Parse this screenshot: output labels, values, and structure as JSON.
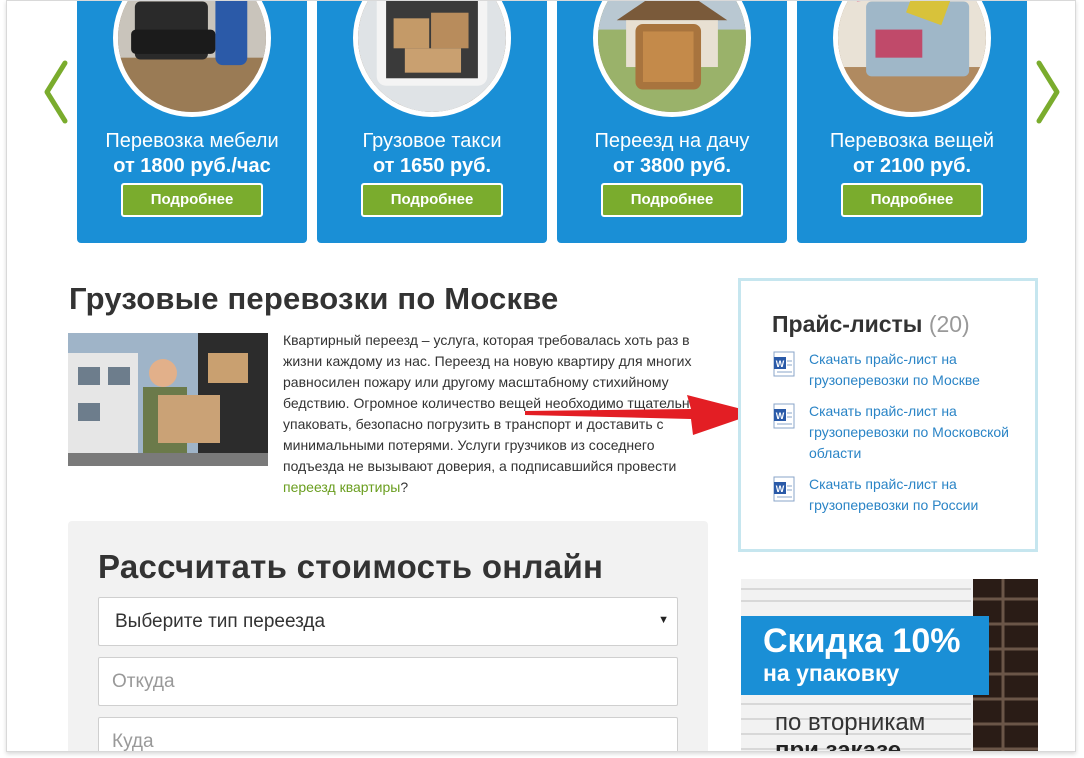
{
  "carousel": {
    "cards": [
      {
        "title": "Перевозка мебели",
        "price": "от 1800 руб./час",
        "button": "Подробнее"
      },
      {
        "title": "Грузовое такси",
        "price": "от 1650 руб.",
        "button": "Подробнее"
      },
      {
        "title": "Переезд на дачу",
        "price": "от 3800 руб.",
        "button": "Подробнее"
      },
      {
        "title": "Перевозка вещей",
        "price": "от 2100 руб.",
        "button": "Подробнее"
      }
    ],
    "icons": {
      "prev": "chevron-left-icon",
      "next": "chevron-right-icon"
    }
  },
  "main": {
    "title": "Грузовые перевозки по Москве",
    "intro": "Квартирный переезд – услуга, которая требовалась хоть раз в жизни каждому из нас. Переезд на новую квартиру для многих равносилен пожару или другому масштабному стихийному бедствию. Огромное количество вещей необходимо тщательно упаковать, безопасно погрузить в транспорт и доставить с минимальными потерями. Услуги грузчиков из соседнего подъезда не вызывают доверия, а подписавшийся провести ",
    "intro_link": "переезд квартиры",
    "intro_end": "?"
  },
  "price_lists": {
    "title": "Прайс-листы",
    "count": "(20)",
    "items": [
      {
        "label": "Скачать прайс-лист на грузоперевозки по Москве"
      },
      {
        "label": "Скачать прайс-лист на грузоперевозки по Московской области"
      },
      {
        "label": "Скачать прайс-лист на грузоперевозки по России"
      }
    ],
    "icon": "word-document-icon"
  },
  "calculator": {
    "title": "Рассчитать стоимость онлайн",
    "select_value": "Выберите тип переезда",
    "from_placeholder": "Откуда",
    "to_placeholder": "Куда"
  },
  "promo": {
    "big": "Скидка 10%",
    "small": "на упаковку",
    "line1": "по вторникам",
    "line2": "при заказе"
  },
  "colors": {
    "card_blue": "#1a8fd6",
    "button_green": "#7aac2d",
    "link_blue": "#2a84c6",
    "link_green": "#6a9e1f",
    "arrow_red": "#e31e24"
  }
}
